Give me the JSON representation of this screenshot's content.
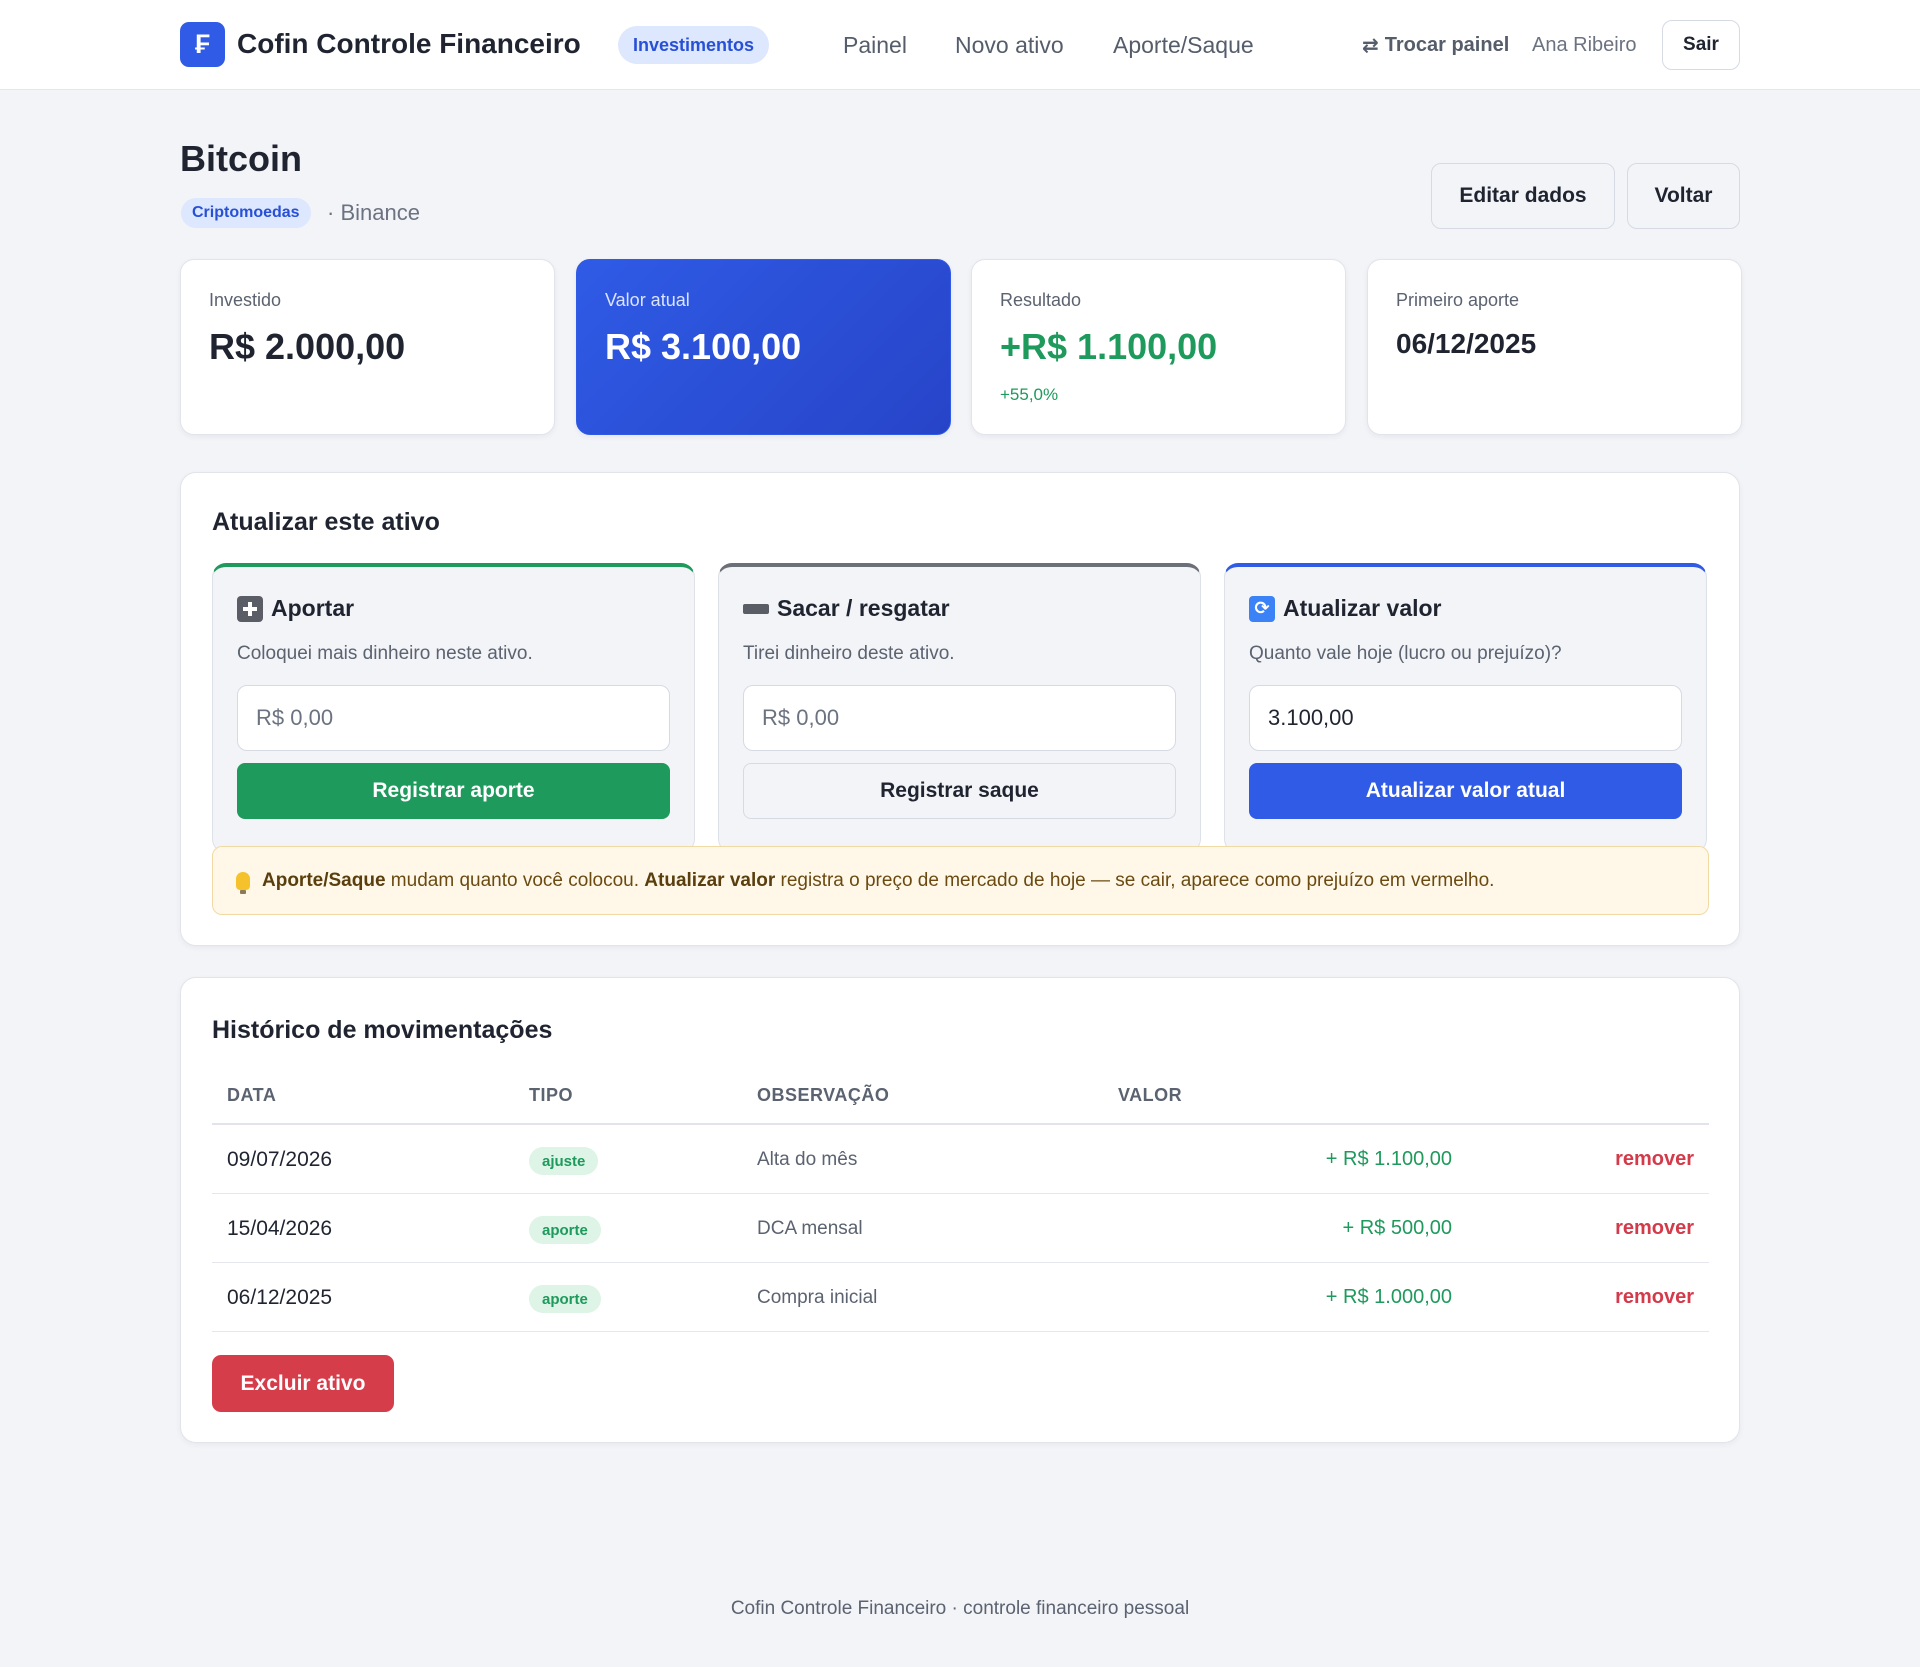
{
  "header": {
    "logo_glyph": "₣",
    "app_name": "Cofin Controle Financeiro",
    "section": "Investimentos",
    "nav": [
      "Painel",
      "Novo ativo",
      "Aporte/Saque"
    ],
    "switch_panel": "Trocar painel",
    "switch_icon": "⇄",
    "user": "Ana Ribeiro",
    "logout": "Sair"
  },
  "asset": {
    "name": "Bitcoin",
    "category": "Criptomoedas",
    "broker": "· Binance",
    "edit_label": "Editar dados",
    "back_label": "Voltar"
  },
  "stats": {
    "invested": {
      "label": "Investido",
      "value": "R$ 2.000,00"
    },
    "current": {
      "label": "Valor atual",
      "value": "R$ 3.100,00"
    },
    "result": {
      "label": "Resultado",
      "value": "+R$ 1.100,00",
      "percent": "+55,0%"
    },
    "first": {
      "label": "Primeiro aporte",
      "value": "06/12/2025"
    }
  },
  "update": {
    "title": "Atualizar este ativo",
    "contribute": {
      "title": "Aportar",
      "desc": "Coloquei mais dinheiro neste ativo.",
      "placeholder": "R$ 0,00",
      "button": "Registrar aporte"
    },
    "withdraw": {
      "title": "Sacar / resgatar",
      "desc": "Tirei dinheiro deste ativo.",
      "placeholder": "R$ 0,00",
      "button": "Registrar saque"
    },
    "revalue": {
      "title": "Atualizar valor",
      "desc": "Quanto vale hoje (lucro ou prejuízo)?",
      "value": "3.100,00",
      "button": "Atualizar valor atual"
    },
    "tip": {
      "bold1": "Aporte/Saque",
      "text1": " mudam quanto você colocou. ",
      "bold2": "Atualizar valor",
      "text2": " registra o preço de mercado de hoje — se cair, aparece como prejuízo em vermelho."
    }
  },
  "history": {
    "title": "Histórico de movimentações",
    "columns": [
      "DATA",
      "TIPO",
      "OBSERVAÇÃO",
      "VALOR"
    ],
    "rows": [
      {
        "date": "09/07/2026",
        "type": "ajuste",
        "note": "Alta do mês",
        "value": "+ R$ 1.100,00",
        "action": "remover"
      },
      {
        "date": "15/04/2026",
        "type": "aporte",
        "note": "DCA mensal",
        "value": "+ R$ 500,00",
        "action": "remover"
      },
      {
        "date": "06/12/2025",
        "type": "aporte",
        "note": "Compra inicial",
        "value": "+ R$ 1.000,00",
        "action": "remover"
      }
    ],
    "delete_label": "Excluir ativo"
  },
  "footer": "Cofin Controle Financeiro · controle financeiro pessoal",
  "colors": {
    "accent": "#2f5be6",
    "positive": "#1e9a5c",
    "danger": "#d63d4a",
    "tip_background": "#fff8e8"
  },
  "icons": {
    "logo": "finance-logo-icon",
    "switch": "swap-arrows-icon",
    "contribute": "plus-icon",
    "withdraw": "minus-icon",
    "revalue": "refresh-icon",
    "tip": "lightbulb-icon"
  }
}
